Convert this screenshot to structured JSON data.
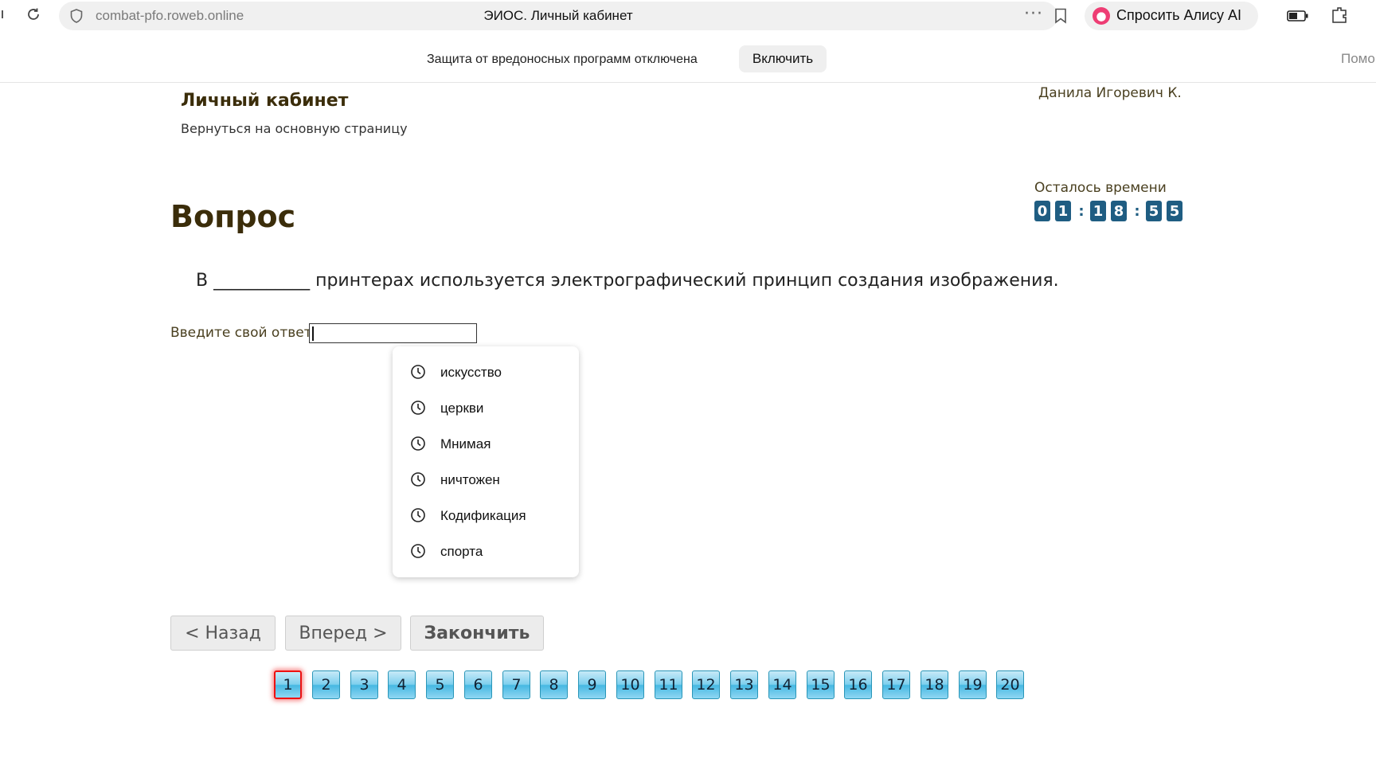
{
  "browser": {
    "url": "combat-pfo.roweb.online",
    "page_title": "ЭИОС. Личный кабинет",
    "menu_dots": "···",
    "alice_label": "Спросить Алису AI"
  },
  "protection_bar": {
    "message": "Защита от вредоносных программ отключена",
    "enable_button": "Включить",
    "help_link": "Помо"
  },
  "header": {
    "title": "Личный кабинет",
    "back_link": "Вернуться на основную страницу",
    "user_name": "Данила Игоревич К."
  },
  "timer": {
    "label": "Осталось времени",
    "digits": [
      "0",
      "1",
      "1",
      "8",
      "5",
      "5"
    ],
    "separator": ":"
  },
  "question": {
    "heading": "Вопрос",
    "text": "В ___________ принтерах используется электрографический принцип создания изображения.",
    "answer_label": "Введите свой ответ",
    "answer_value": ""
  },
  "autocomplete": {
    "items": [
      "искусство",
      "церкви",
      "Мнимая",
      "ничтожен",
      "Кодификация",
      "спорта"
    ]
  },
  "navigation": {
    "back": "< Назад",
    "forward": "Вперед >",
    "finish": "Закончить"
  },
  "pages": {
    "current": 1,
    "labels": [
      "1",
      "2",
      "3",
      "4",
      "5",
      "6",
      "7",
      "8",
      "9",
      "10",
      "11",
      "12",
      "13",
      "14",
      "15",
      "16",
      "17",
      "18",
      "19",
      "20"
    ]
  }
}
